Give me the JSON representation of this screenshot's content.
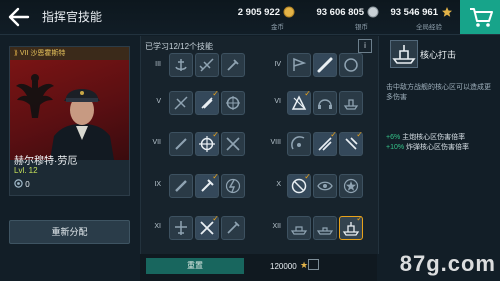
{
  "header": {
    "title": "指挥官技能",
    "resources": [
      {
        "value": "2 905 922",
        "label": "金币",
        "icon": "gold-coin-icon"
      },
      {
        "value": "93 606 805",
        "label": "银币",
        "icon": "silver-coin-icon"
      },
      {
        "value": "93 546 961",
        "label": "全局经验",
        "icon": "star-xp-icon"
      }
    ],
    "shop_icon": "cart-icon"
  },
  "commander": {
    "nation": "VII 沙恩霍斯特",
    "name": "赫尔穆特·劳厄",
    "level": "Lvl. 12",
    "points": "0"
  },
  "reassign_label": "重新分配",
  "skills": {
    "learned": "已学习12/12个技能",
    "info_label": "i",
    "tiers": [
      {
        "label": "III",
        "side": "left"
      },
      {
        "label": "IV",
        "side": "right"
      },
      {
        "label": "V",
        "side": "left"
      },
      {
        "label": "VI",
        "side": "right"
      },
      {
        "label": "VII",
        "side": "left"
      },
      {
        "label": "VIII",
        "side": "right"
      },
      {
        "label": "IX",
        "side": "left"
      },
      {
        "label": "X",
        "side": "right"
      },
      {
        "label": "XI",
        "side": "left"
      },
      {
        "label": "XII",
        "side": "right"
      }
    ],
    "reset_label": "重置",
    "cost": "120000"
  },
  "detail": {
    "title": "核心打击",
    "description": "击中敌方战舰的核心区可以造成更多伤害",
    "stats": [
      {
        "value": "+6%",
        "text": "主炮核心区伤害倍率"
      },
      {
        "value": "+10%",
        "text": "炸弹核心区伤害倍率"
      }
    ]
  },
  "watermark": "87g.com",
  "colors": {
    "accent_green": "#17a48a",
    "selected_border": "#e8a21a",
    "level_text": "#c5e15a",
    "stat_green": "#35c48a"
  }
}
